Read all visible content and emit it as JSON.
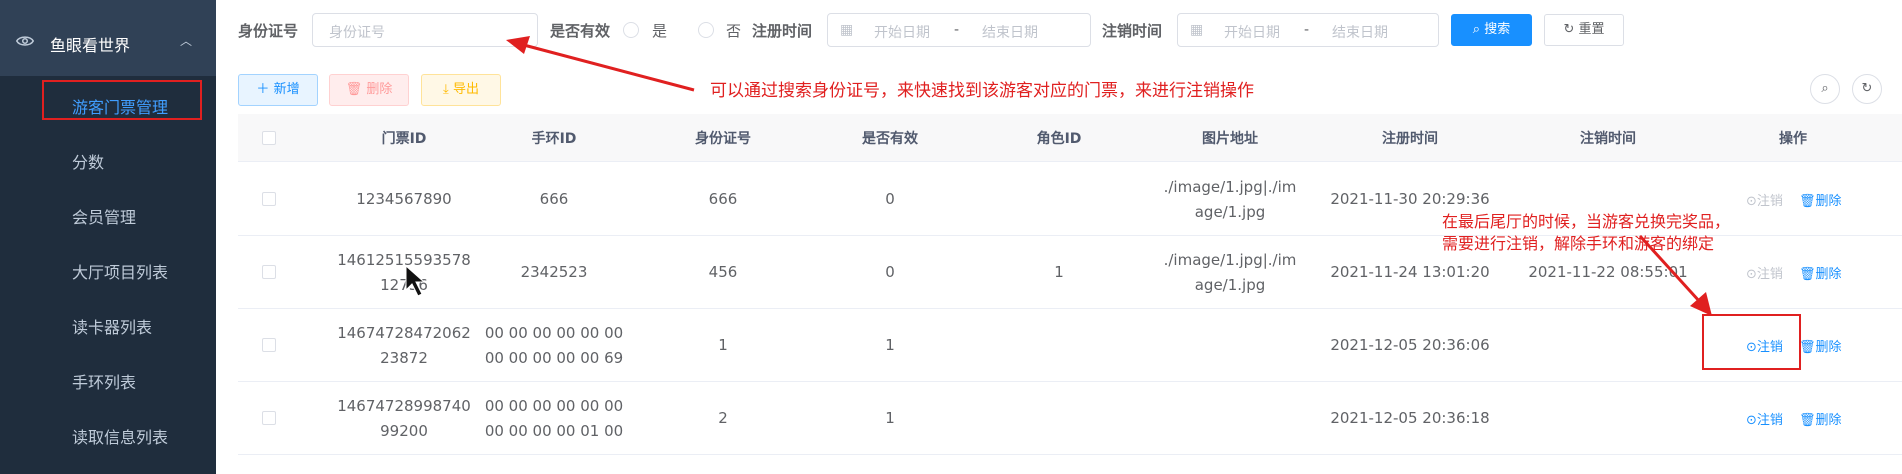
{
  "sidebar": {
    "title": "鱼眼看世界",
    "items": [
      {
        "label": "游客门票管理",
        "active": true
      },
      {
        "label": "分数"
      },
      {
        "label": "会员管理"
      },
      {
        "label": "大厅项目列表"
      },
      {
        "label": "读卡器列表"
      },
      {
        "label": "手环列表"
      },
      {
        "label": "读取信息列表"
      }
    ]
  },
  "search": {
    "id_label": "身份证号",
    "id_placeholder": "身份证号",
    "valid_label": "是否有效",
    "valid_yes": "是",
    "valid_no": "否",
    "reg_label": "注册时间",
    "reg_start": "开始日期",
    "reg_end": "结束日期",
    "cancel_label": "注销时间",
    "cancel_start": "开始日期",
    "cancel_end": "结束日期",
    "dash": "-",
    "search_btn": "搜索",
    "reset_btn": "重置"
  },
  "toolbar": {
    "add": "新增",
    "delete": "删除",
    "export": "导出"
  },
  "table": {
    "headers": [
      "门票ID",
      "手环ID",
      "身份证号",
      "是否有效",
      "角色ID",
      "图片地址",
      "注册时间",
      "注销时间",
      "操作"
    ],
    "rows": [
      {
        "ticket_id": "1234567890",
        "band_id": "666",
        "id_no": "666",
        "valid": "0",
        "role": "",
        "img": "./image/1.jpg|./image/1.jpg",
        "reg": "2021-11-30 20:29:36",
        "cancel": "",
        "cancel_enabled": false
      },
      {
        "ticket_id": "1461251559357812736",
        "band_id": "2342523",
        "id_no": "456",
        "valid": "0",
        "role": "1",
        "img": "./image/1.jpg|./image/1.jpg",
        "reg": "2021-11-24 13:01:20",
        "cancel": "2021-11-22 08:55:01",
        "cancel_enabled": false
      },
      {
        "ticket_id": "1467472847206223872",
        "band_id": "00 00 00 00 00 00 00 00 00 00 00 69",
        "id_no": "1",
        "valid": "1",
        "role": "",
        "img": "",
        "reg": "2021-12-05 20:36:06",
        "cancel": "",
        "cancel_enabled": true
      },
      {
        "ticket_id": "1467472899874099200",
        "band_id": "00 00 00 00 00 00 00 00 00 00 01 00",
        "id_no": "2",
        "valid": "1",
        "role": "",
        "img": "",
        "reg": "2021-12-05 20:36:18",
        "cancel": "",
        "cancel_enabled": true
      }
    ],
    "op_cancel": "注销",
    "op_delete": "删除"
  },
  "annotations": {
    "search_note": "可以通过搜索身份证号，来快速找到该游客对应的门票，来进行注销操作",
    "cancel_note_line1": "在最后尾厅的时候，当游客兑换完奖品，",
    "cancel_note_line2": "需要进行注销，解除手环和游客的绑定"
  },
  "colors": {
    "sidebar_bg": "#304156",
    "primary": "#1890ff",
    "annotation_red": "#e02020"
  }
}
